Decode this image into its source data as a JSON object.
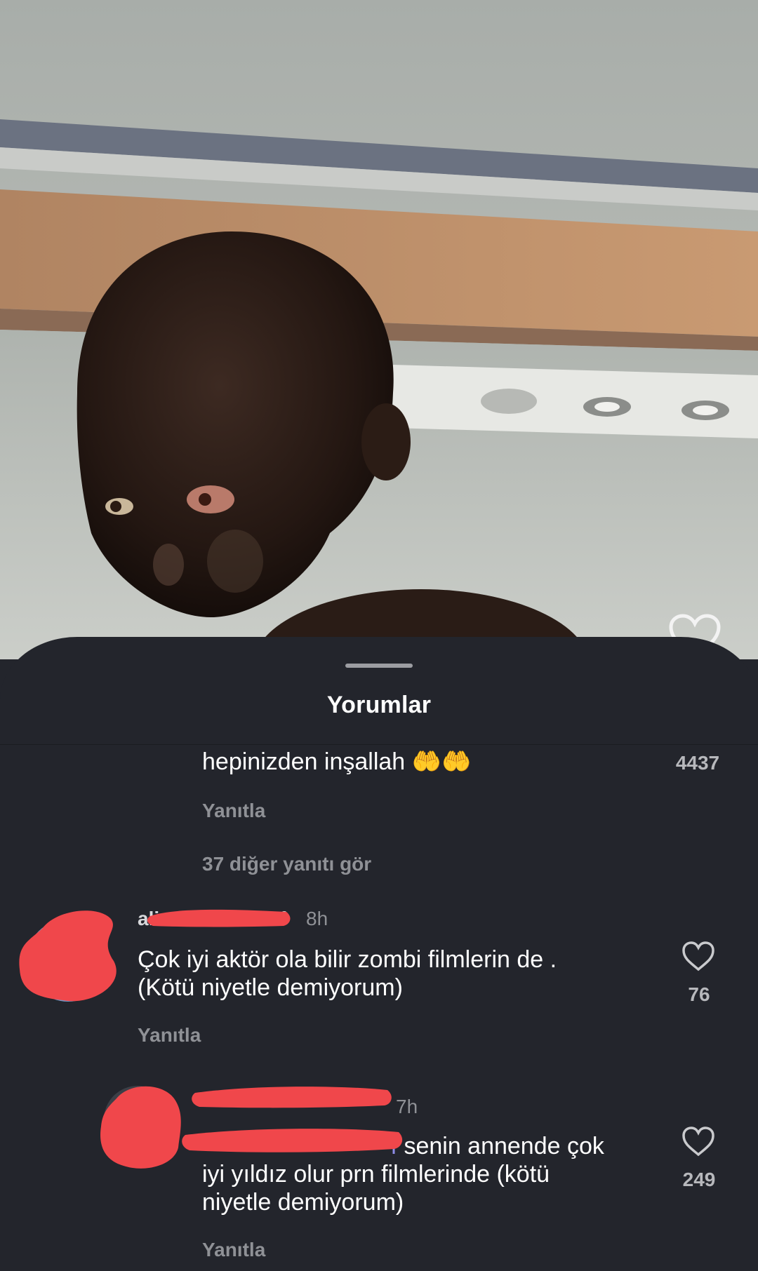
{
  "sheet": {
    "title": "Yorumlar"
  },
  "comments": [
    {
      "text": "hepinizden inşallah 🤲🤲",
      "likes": "4437",
      "reply_label": "Yanıtla",
      "more_replies": "37 diğer yanıtı gör"
    },
    {
      "username": "ali",
      "username_end": "f",
      "time": "8h",
      "line1": "Çok iyi aktör ola bilir zombi filmlerin de .",
      "line2": "(Kötü niyetle demiyorum)",
      "likes": "76",
      "reply_label": "Yanıtla"
    },
    {
      "username": "",
      "time": "7h",
      "mention": "f",
      "line1": " senin annende çok",
      "line2": "iyi yıldız olur prn filmlerinde (kötü",
      "line3": "niyetle demiyorum)",
      "likes": "249",
      "reply_label": "Yanıtla"
    }
  ],
  "icons": {
    "like": "heart-outline-icon",
    "video_like": "heart-outline-icon"
  },
  "colors": {
    "sheet_background": "#23252c",
    "muted_text": "#8f9196",
    "mention": "#8f8de8",
    "redaction": "#f0474b"
  }
}
